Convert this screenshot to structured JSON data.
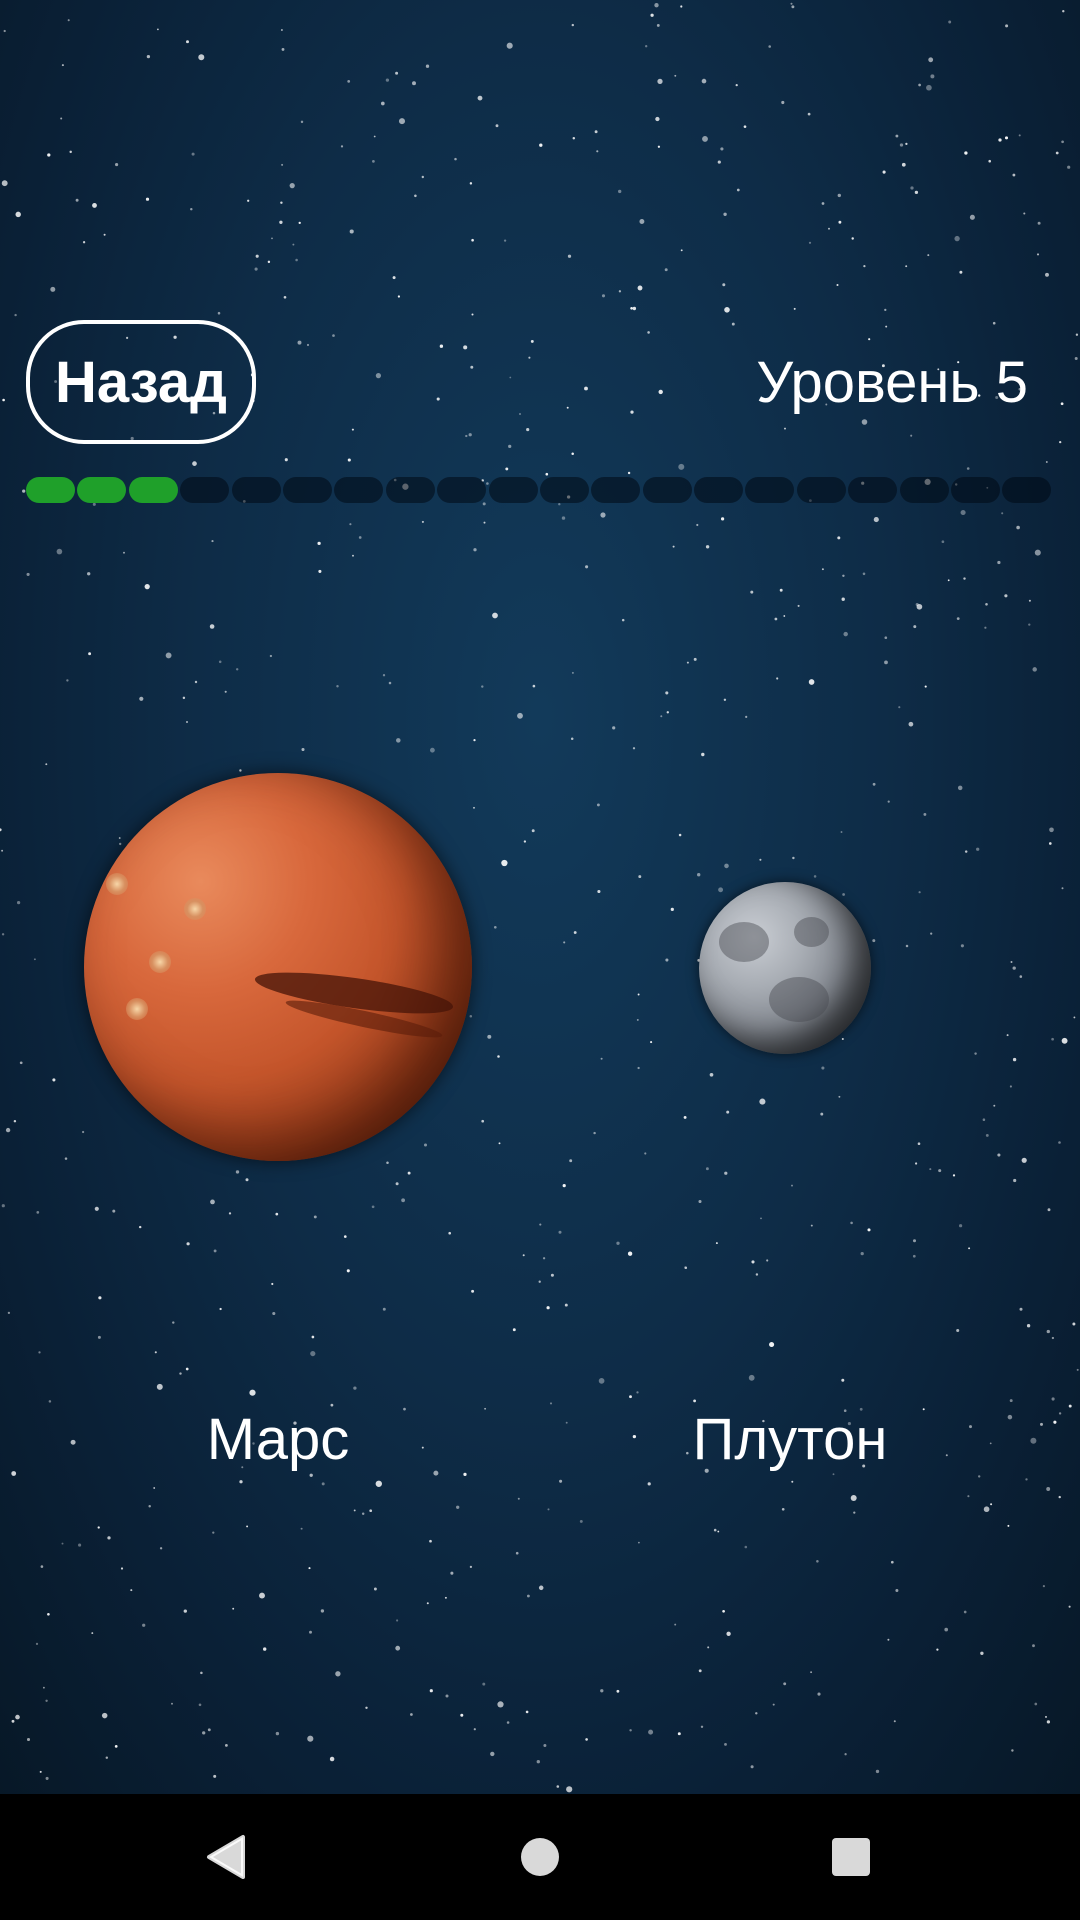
{
  "header": {
    "back_label": "Назад",
    "level_label": "Уровень 5"
  },
  "progress": {
    "completed": 3,
    "total": 20,
    "done_color": "#1fa02a"
  },
  "planets": {
    "left": {
      "name": "Марс",
      "icon": "mars-planet"
    },
    "right": {
      "name": "Плутон",
      "icon": "pluto-planet"
    }
  },
  "navbar": {
    "back_icon": "triangle-back-icon",
    "home_icon": "circle-home-icon",
    "recent_icon": "square-recent-icon"
  },
  "colors": {
    "background": "#0e2c47",
    "text": "#ffffff",
    "navbar": "#000000"
  }
}
